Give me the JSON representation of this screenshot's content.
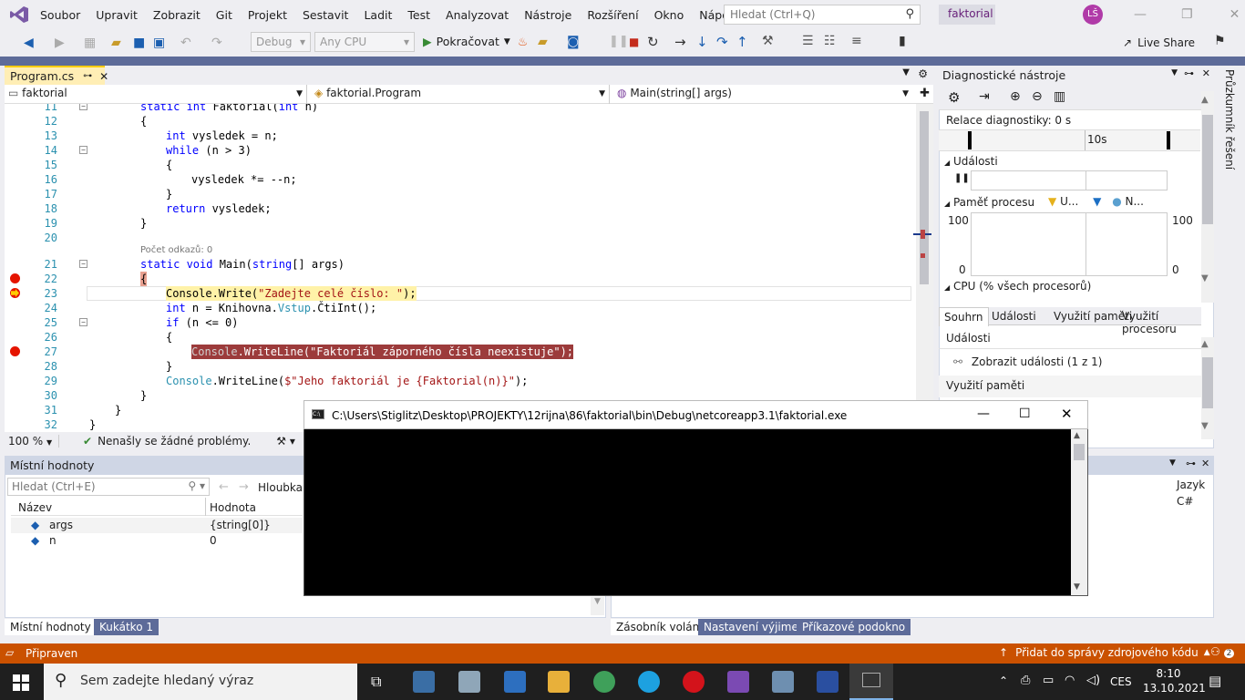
{
  "menu": {
    "items": [
      "Soubor",
      "Upravit",
      "Zobrazit",
      "Git",
      "Projekt",
      "Sestavit",
      "Ladit",
      "Test",
      "Analyzovat",
      "Nástroje",
      "Rozšíření",
      "Okno",
      "Nápověda"
    ],
    "search_placeholder": "Hledat (Ctrl+Q)",
    "solution_name": "faktorial",
    "user_initials": "LŠ"
  },
  "toolbar": {
    "config": "Debug",
    "platform": "Any CPU",
    "continue_label": "Pokračovat",
    "live_share": "Live Share"
  },
  "editor": {
    "tab_name": "Program.cs",
    "nav": [
      "faktorial",
      "faktorial.Program",
      "Main(string[] args)"
    ],
    "zoom": "100 %",
    "status": "Nenašly se žádné problémy.",
    "ref_hint": "Počet odkazů: 0",
    "lines": [
      {
        "n": "11",
        "t": "static int Faktorial(int n)"
      },
      {
        "n": "12",
        "t": "{"
      },
      {
        "n": "13",
        "t": "    int vysledek = n;"
      },
      {
        "n": "14",
        "t": "    while (n > 3)"
      },
      {
        "n": "15",
        "t": "    {"
      },
      {
        "n": "16",
        "t": "        vysledek *= --n;"
      },
      {
        "n": "17",
        "t": "    }"
      },
      {
        "n": "18",
        "t": "    return vysledek;"
      },
      {
        "n": "19",
        "t": "}"
      },
      {
        "n": "20",
        "t": ""
      },
      {
        "n": "21",
        "t": "static void Main(string[] args)"
      },
      {
        "n": "22",
        "t": "{"
      },
      {
        "n": "23",
        "t": "    Console.Write(\"Zadejte celé číslo: \");"
      },
      {
        "n": "24",
        "t": "    int n = Knihovna.Vstup.ČtiInt();"
      },
      {
        "n": "25",
        "t": "    if (n <= 0)"
      },
      {
        "n": "26",
        "t": "    {"
      },
      {
        "n": "27",
        "t": "        Console.WriteLine(\"Faktoriál záporného čísla neexistuje\");"
      },
      {
        "n": "28",
        "t": "    }"
      },
      {
        "n": "29",
        "t": "    Console.WriteLine($\"Jeho faktoriál je {Faktorial(n)}\");"
      },
      {
        "n": "30",
        "t": "}"
      },
      {
        "n": "31",
        "t": "}"
      },
      {
        "n": "32",
        "t": "}"
      }
    ]
  },
  "locals": {
    "title": "Místní hodnoty",
    "search_placeholder": "Hledat (Ctrl+E)",
    "depth_label": "Hloubka h",
    "col_name": "Název",
    "col_value": "Hodnota",
    "rows": [
      {
        "name": "args",
        "value": "{string[0]}"
      },
      {
        "name": "n",
        "value": "0"
      }
    ],
    "tabs": [
      "Místní hodnoty",
      "Kukátko 1"
    ]
  },
  "diagnostics": {
    "title": "Diagnostické nástroje",
    "session": "Relace diagnostiky: 0 s",
    "timeline_mark": "10s",
    "events": "Události",
    "memory": "Paměť procesu",
    "mem_legend_1": "U...",
    "mem_legend_2": "N...",
    "axis_top_l": "100",
    "axis_top_r": "100",
    "axis_bottom_l": "0",
    "axis_bottom_r": "0",
    "cpu": "CPU (% všech procesorů)",
    "tabs": [
      "Souhrn",
      "Události",
      "Využití paměti",
      "Využití procesoru"
    ],
    "section_events": "Události",
    "show_events": "Zobrazit události (1 z 1)",
    "section_memory": "Využití paměti",
    "side_label": "Průzkumník řešení"
  },
  "callstack": {
    "col_lang": "Jazyk",
    "lang_value": "C#",
    "tabs": [
      "Zásobník volání",
      "Nastavení výjimek",
      "Příkazové podokno"
    ]
  },
  "console": {
    "title": "C:\\Users\\Stiglitz\\Desktop\\PROJEKTY\\12rijna\\86\\faktorial\\bin\\Debug\\netcoreapp3.1\\faktorial.exe"
  },
  "status": {
    "ready": "Připraven",
    "source_control": "Přidat do správy zdrojového kódu",
    "notifications": "2"
  },
  "taskbar": {
    "search_placeholder": "Sem zadejte hledaný výraz",
    "lang": "CES",
    "time": "8:10",
    "date": "13.10.2021"
  },
  "colors": {
    "status_bar": "#ca5100",
    "accent": "#5d6b99",
    "breakpoint": "#e51400"
  }
}
